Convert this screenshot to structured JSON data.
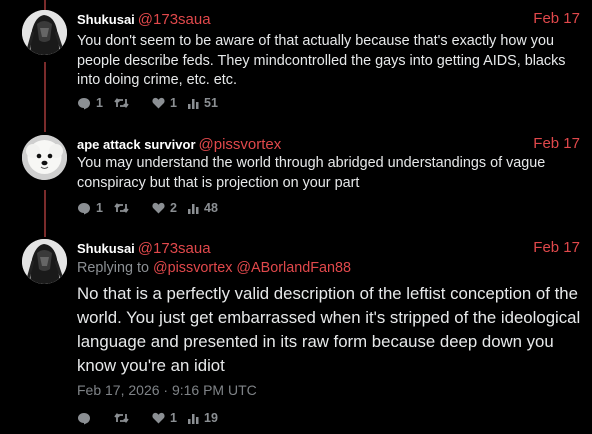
{
  "tweets": [
    {
      "name": "Shukusai",
      "handle": "@173saua",
      "date": "Feb 17",
      "text": "You don't seem to be aware of that actually because that's exactly how you people describe feds. They mindcontrolled the gays into getting AIDS, blacks into doing crime, etc. etc.",
      "replies": "1",
      "retweets": "",
      "likes": "1",
      "views": "51",
      "avatar": "dark-figure-avatar"
    },
    {
      "name": "ape attack survivor",
      "handle": "@pissvortex",
      "date": "Feb 17",
      "text": "You may understand the world through abridged understandings of vague conspiracy but that is projection on your part",
      "replies": "1",
      "retweets": "",
      "likes": "2",
      "views": "48",
      "avatar": "white-dog-avatar"
    },
    {
      "name": "Shukusai",
      "handle": "@173saua",
      "date": "Feb 17",
      "replying_prefix": "Replying to",
      "replying_to": [
        "@pissvortex",
        "@ABorlandFan88"
      ],
      "text": "No that is a perfectly valid description of the leftist conception of the world. You just get embarrassed when it's stripped of the ideological language and presented in its raw form because deep down you know you're an idiot",
      "timestamp": "Feb 17, 2026 · 9:16 PM UTC",
      "replies": "",
      "retweets": "",
      "likes": "1",
      "views": "19",
      "avatar": "dark-figure-avatar"
    }
  ],
  "colors": {
    "background": "#000000",
    "accent": "#e0484b",
    "thread_line": "#7a2b2b",
    "muted": "#8b8f93"
  }
}
